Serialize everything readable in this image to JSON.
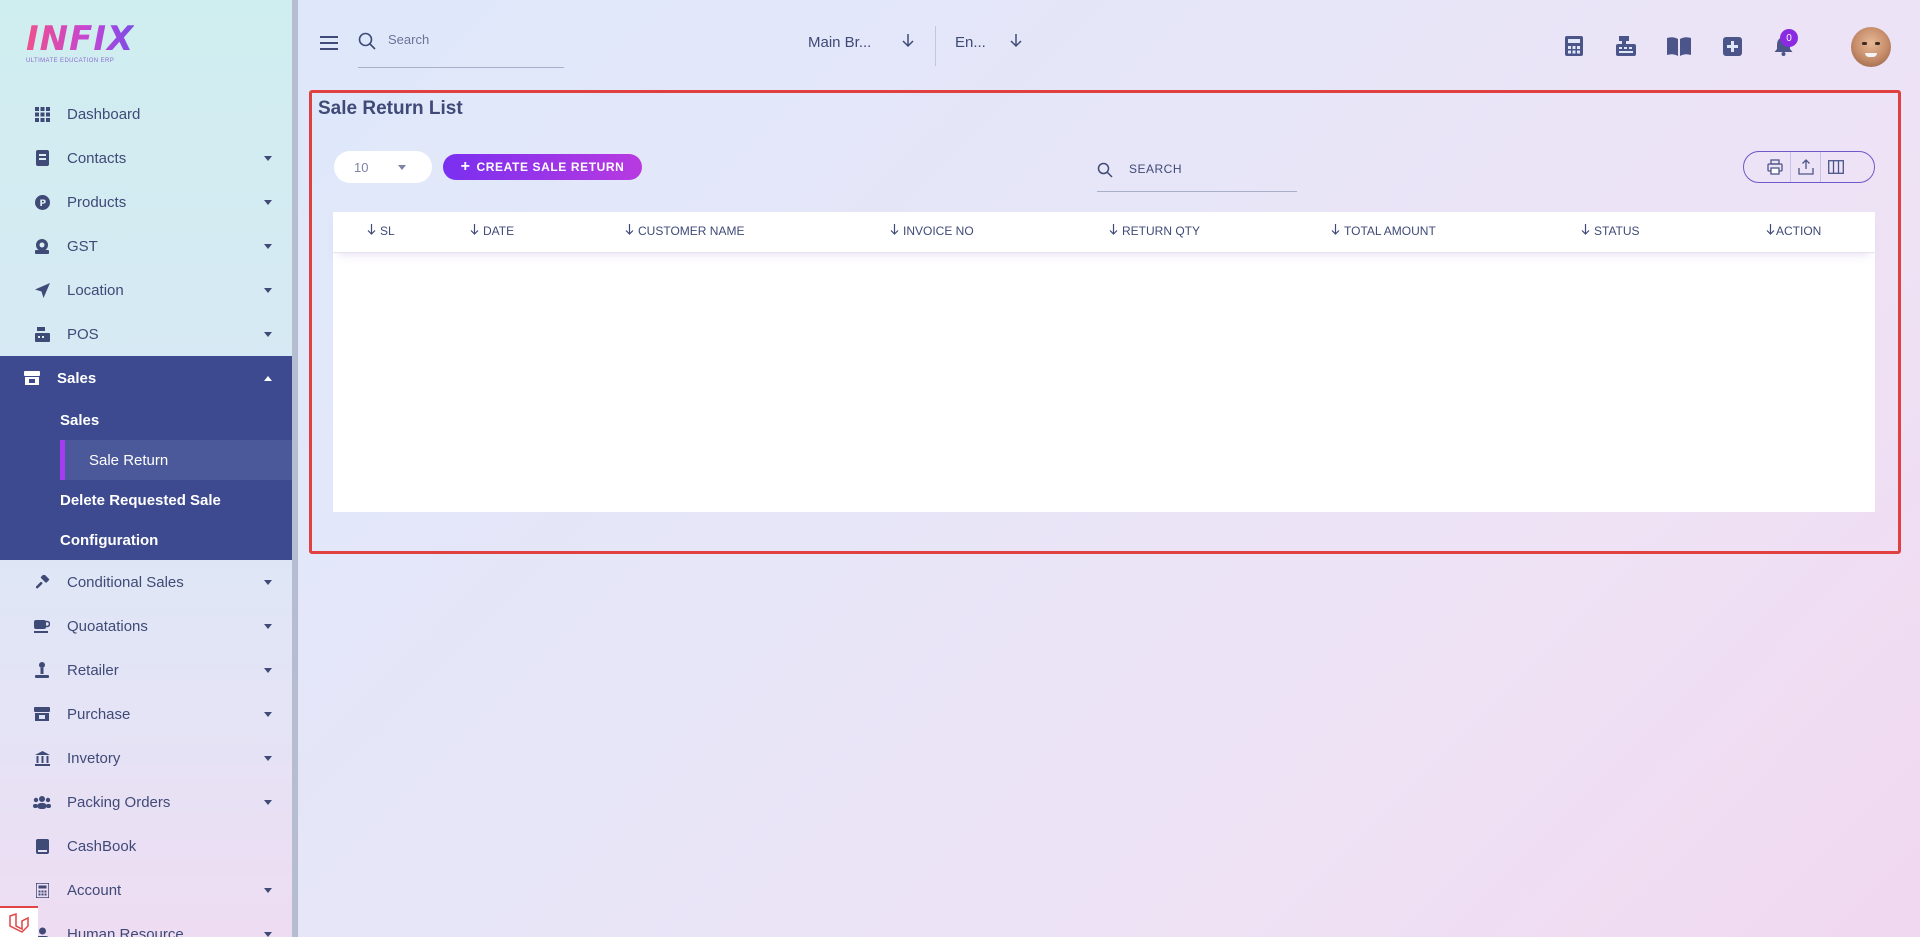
{
  "logo": {
    "brand": "INFIX",
    "tagline": "ULTIMATE EDUCATION ERP"
  },
  "sidebar": {
    "items_top": [
      {
        "label": "Dashboard",
        "icon": "grid-icon",
        "caret": false
      },
      {
        "label": "Contacts",
        "icon": "contacts-icon",
        "caret": true
      },
      {
        "label": "Products",
        "icon": "product-icon",
        "caret": true
      },
      {
        "label": "GST",
        "icon": "gst-icon",
        "caret": true
      },
      {
        "label": "Location",
        "icon": "location-arrow-icon",
        "caret": true
      },
      {
        "label": "POS",
        "icon": "pos-icon",
        "caret": true
      }
    ],
    "sales": {
      "label": "Sales",
      "sub_items": [
        "Sales",
        "Sale Return",
        "Delete Requested Sale",
        "Configuration"
      ],
      "active": "Sale Return"
    },
    "items_bottom": [
      {
        "label": "Conditional Sales",
        "icon": "gavel-icon",
        "caret": true
      },
      {
        "label": "Quoatations",
        "icon": "coffee-icon",
        "caret": true
      },
      {
        "label": "Retailer",
        "icon": "retailer-icon",
        "caret": true
      },
      {
        "label": "Purchase",
        "icon": "store-icon",
        "caret": true
      },
      {
        "label": "Invetory",
        "icon": "bank-icon",
        "caret": true
      },
      {
        "label": "Packing Orders",
        "icon": "users-icon",
        "caret": true
      },
      {
        "label": "CashBook",
        "icon": "book-icon",
        "caret": false
      },
      {
        "label": "Account",
        "icon": "calculator-icon",
        "caret": true
      },
      {
        "label": "Human Resource",
        "icon": "hr-icon",
        "caret": true
      }
    ]
  },
  "header": {
    "search_placeholder": "Search",
    "branch": "Main Br...",
    "language": "En...",
    "notification_count": "0"
  },
  "main": {
    "title": "Sale Return List",
    "page_size": "10",
    "create_button": "CREATE SALE RETURN",
    "search_placeholder": "SEARCH",
    "columns": [
      "SL",
      "DATE",
      "CUSTOMER NAME",
      "INVOICE NO",
      "RETURN QTY",
      "TOTAL AMOUNT",
      "STATUS",
      "ACTION"
    ]
  },
  "colors": {
    "sidebar_active_bg": "#3d4a8f",
    "accent_purple": "#7a2ff0",
    "frame_red": "#e14040",
    "text": "#3f4a77"
  }
}
